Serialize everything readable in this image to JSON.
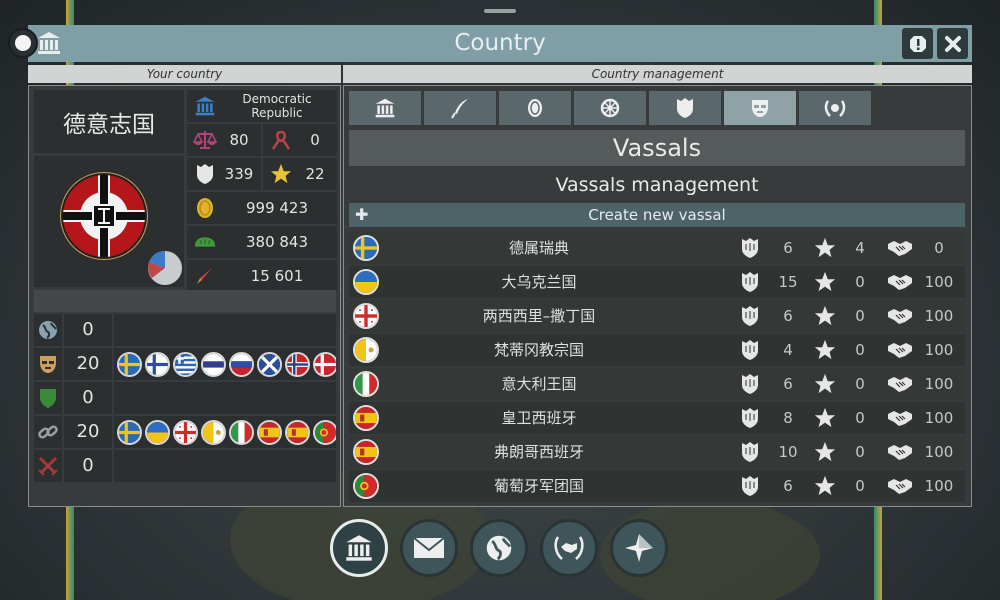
{
  "window": {
    "title": "Country",
    "left_header": "Your country",
    "right_header": "Country management"
  },
  "country": {
    "name": "德意志国",
    "government": "Democratic Republic",
    "justice": "80",
    "ribbon": "0",
    "military": "339",
    "stars": "22",
    "money": "999 423",
    "food": "380 843",
    "rockets": "15 601"
  },
  "relations": [
    {
      "icon": "globe-icon",
      "count": "0",
      "flags": []
    },
    {
      "icon": "mask-icon",
      "count": "20",
      "flags": [
        "se",
        "fi",
        "gr",
        "ru-h",
        "ru",
        "scot",
        "no",
        "dk"
      ]
    },
    {
      "icon": "shield-icon",
      "count": "0",
      "flags": []
    },
    {
      "icon": "chain-icon",
      "count": "20",
      "flags": [
        "se",
        "ua",
        "ge",
        "va",
        "it",
        "es",
        "es",
        "pt"
      ]
    },
    {
      "icon": "swords-icon",
      "count": "0",
      "flags": []
    }
  ],
  "management": {
    "tabs": [
      "capitol-icon",
      "quill-icon",
      "coin-icon",
      "wheel-icon",
      "helmet-icon",
      "mask-icon",
      "laurel-icon"
    ],
    "active_tab": 5,
    "section_title": "Vassals",
    "subtitle": "Vassals management",
    "create_label": "Create new vassal"
  },
  "vassals": [
    {
      "name": "德属瑞典",
      "flag": "se",
      "military": "6",
      "stars": "4",
      "relation": "0"
    },
    {
      "name": "大乌克兰国",
      "flag": "ua",
      "military": "15",
      "stars": "0",
      "relation": "100"
    },
    {
      "name": "两西西里–撒丁国",
      "flag": "ge",
      "military": "6",
      "stars": "0",
      "relation": "100"
    },
    {
      "name": "梵蒂冈教宗国",
      "flag": "va",
      "military": "4",
      "stars": "0",
      "relation": "100"
    },
    {
      "name": "意大利王国",
      "flag": "it",
      "military": "6",
      "stars": "0",
      "relation": "100"
    },
    {
      "name": "皇卫西班牙",
      "flag": "es",
      "military": "8",
      "stars": "0",
      "relation": "100"
    },
    {
      "name": "弗朗哥西班牙",
      "flag": "es",
      "military": "10",
      "stars": "0",
      "relation": "100"
    },
    {
      "name": "葡萄牙军团国",
      "flag": "pt",
      "military": "6",
      "stars": "0",
      "relation": "100"
    }
  ],
  "bottom_nav": [
    "capitol-icon",
    "mail-icon",
    "globe-icon",
    "handshake-laurel-icon",
    "compass-icon"
  ],
  "colors": {
    "titlebar": "#7f9ea6",
    "panel": "#373b3c",
    "accent_create": "#4e6368"
  }
}
